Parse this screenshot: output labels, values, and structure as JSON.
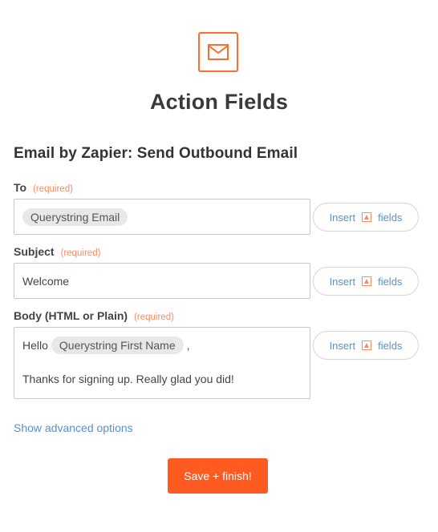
{
  "header": {
    "icon": "mail-icon",
    "title": "Action Fields",
    "section_title": "Email by Zapier: Send Outbound Email"
  },
  "fields": {
    "to": {
      "label": "To",
      "required": "(required)",
      "pill": "Querystring Email"
    },
    "subject": {
      "label": "Subject",
      "required": "(required)",
      "value": "Welcome"
    },
    "body": {
      "label": "Body (HTML or Plain)",
      "required": "(required)",
      "greeting": "Hello",
      "pill": "Querystring First Name",
      "comma": ",",
      "line2": "Thanks for signing up.  Really glad you did!"
    }
  },
  "insert_button": {
    "insert": "Insert",
    "fields": "fields",
    "icon": "insert-field-icon"
  },
  "advanced_link": "Show advanced options",
  "save_button": "Save + finish!",
  "colors": {
    "accent": "#ff6d2d",
    "link": "#5b8fcc",
    "button": "#ff5a1f"
  }
}
